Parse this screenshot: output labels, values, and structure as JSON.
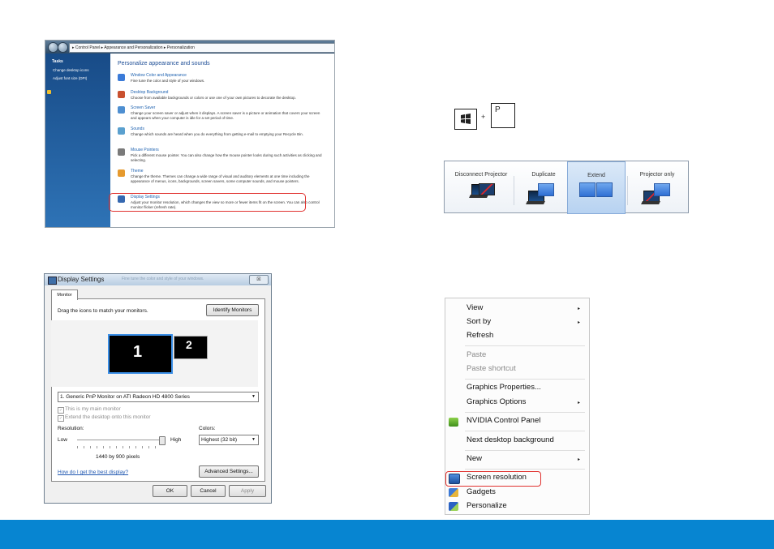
{
  "personalization": {
    "breadcrumb": "▸ Control Panel ▸ Appearance and Personalization ▸ Personalization",
    "sidebar_title": "Tasks",
    "sidebar_links": [
      "Change desktop icons",
      "Adjust font size (DPI)"
    ],
    "heading": "Personalize appearance and sounds",
    "items": [
      {
        "label": "Window Color and Appearance",
        "desc": "Fine tune the color and style of your windows.",
        "icon_color": "#3b7bd8"
      },
      {
        "label": "Desktop Background",
        "desc": "Choose from available backgrounds or colors or use one of your own pictures to decorate the desktop.",
        "icon_color": "#c9502f"
      },
      {
        "label": "Screen Saver",
        "desc": "Change your screen saver or adjust when it displays. A screen saver is a picture or animation that covers your screen and appears when your computer is idle for a set period of time.",
        "icon_color": "#4e8fd1"
      },
      {
        "label": "Sounds",
        "desc": "Change which sounds are heard when you do everything from getting e-mail to emptying your Recycle Bin.",
        "icon_color": "#5aa0cf"
      },
      {
        "label": "Mouse Pointers",
        "desc": "Pick a different mouse pointer. You can also change how the mouse pointer looks during such activities as clicking and selecting.",
        "icon_color": "#7a7a7a"
      },
      {
        "label": "Theme",
        "desc": "Change the theme. Themes can change a wide range of visual and auditory elements at one time including the appearance of menus, icons, backgrounds, screen savers, some computer sounds, and mouse pointers.",
        "icon_color": "#e69a2e"
      },
      {
        "label": "Display Settings",
        "desc": "Adjust your monitor resolution, which changes the view so more or fewer items fit on the screen. You can also control monitor flicker (refresh rate).",
        "icon_color": "#3568b0"
      }
    ]
  },
  "shortcut": {
    "plus": "+",
    "key": "P",
    "win_icon": "windows-logo-icon"
  },
  "projector": {
    "options": [
      "Disconnect Projector",
      "Duplicate",
      "Extend",
      "Projector only"
    ],
    "selected": "Extend"
  },
  "display_settings": {
    "title": "Display Settings",
    "ghost_text": "Fine tune the color and style of your windows.",
    "close_glyph": "☒",
    "tab": "Monitor",
    "instruction": "Drag the icons to match your monitors.",
    "identify_button": "Identify Monitors",
    "monitor1": "1",
    "monitor2": "2",
    "monitor_select": "1. Generic PnP Monitor on ATI Radeon HD 4800 Series",
    "check_main": "This is my main monitor",
    "check_extend": "Extend the desktop onto this monitor",
    "resolution_label": "Resolution:",
    "low": "Low",
    "high": "High",
    "resolution_value": "1440 by 900 pixels",
    "colors_label": "Colors:",
    "colors_value": "Highest (32 bit)",
    "help_link": "How do I get the best display?",
    "advanced_button": "Advanced Settings...",
    "ok": "OK",
    "cancel": "Cancel",
    "apply": "Apply",
    "slider_position": 1.0
  },
  "context_menu": {
    "items": [
      {
        "label": "View",
        "submenu": true
      },
      {
        "label": "Sort by",
        "submenu": true
      },
      {
        "label": "Refresh",
        "submenu": false
      },
      {
        "label": "Paste",
        "disabled": true
      },
      {
        "label": "Paste shortcut",
        "disabled": true
      },
      {
        "label": "Graphics Properties...",
        "submenu": false
      },
      {
        "label": "Graphics Options",
        "submenu": true
      },
      {
        "label": "NVIDIA Control Panel",
        "submenu": false,
        "icon": "nvidia-icon"
      },
      {
        "label": "Next desktop background",
        "submenu": false
      },
      {
        "label": "New",
        "submenu": true
      },
      {
        "label": "Screen resolution",
        "submenu": false,
        "icon": "monitor-icon",
        "highlighted": true
      },
      {
        "label": "Gadgets",
        "submenu": false,
        "icon": "gadgets-icon"
      },
      {
        "label": "Personalize",
        "submenu": false,
        "icon": "personalize-icon"
      }
    ],
    "submenu_glyph": "▸"
  },
  "footer": {
    "color": "#0785d1"
  }
}
